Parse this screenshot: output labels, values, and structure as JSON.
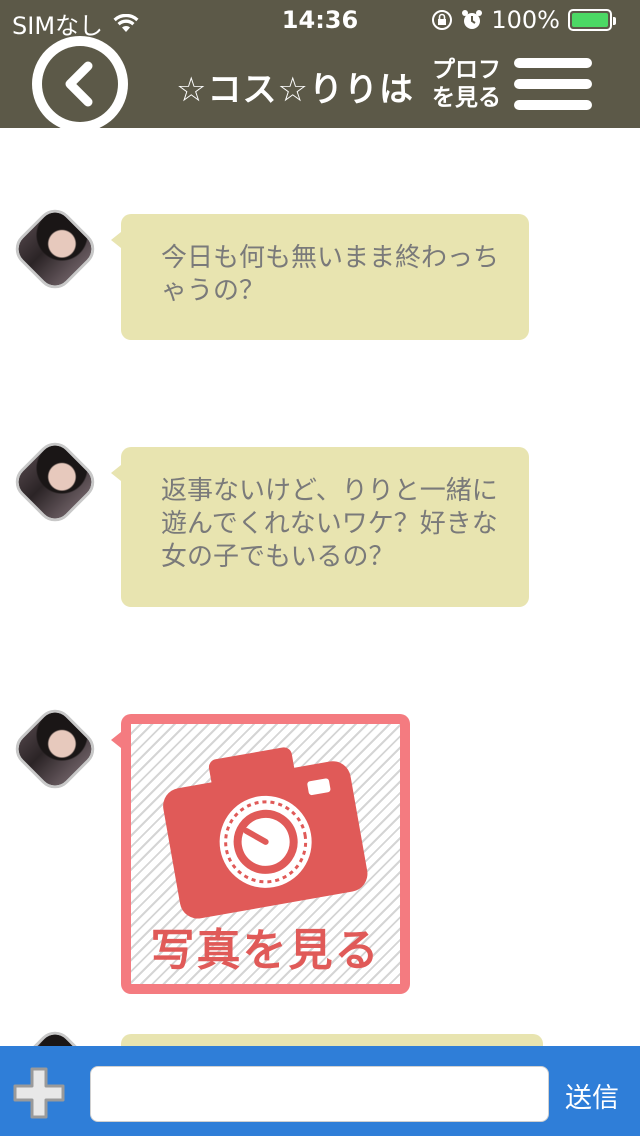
{
  "status_bar": {
    "carrier": "SIMなし",
    "time": "14:36",
    "battery_percent": "100%",
    "battery_level": 1.0
  },
  "header": {
    "title": "☆コス☆りりは",
    "profile_line1": "プロフ",
    "profile_line2": "を見る"
  },
  "messages": [
    {
      "type": "text",
      "text": "今日も何も無いまま終わっちゃうの？"
    },
    {
      "type": "text",
      "text": "返事ないけど、りりと一緒に遊んでくれないワケ？好きな女の子でもいるの？"
    },
    {
      "type": "image",
      "label": "写真を見る"
    },
    {
      "type": "text",
      "text": ""
    }
  ],
  "input_bar": {
    "value": "",
    "placeholder": "",
    "send_label": "送信"
  },
  "colors": {
    "header_bg": "#5c5948",
    "bubble_bg": "#e8e4b0",
    "photo_frame": "#f47b80",
    "photo_icon": "#e05a58",
    "input_bar_bg": "#2f7ed8",
    "battery_fill": "#4cd964"
  },
  "icons": [
    "wifi-icon",
    "rotation-lock-icon",
    "alarm-icon",
    "battery-icon",
    "back-arrow-icon",
    "hamburger-menu-icon",
    "camera-icon",
    "plus-icon"
  ]
}
